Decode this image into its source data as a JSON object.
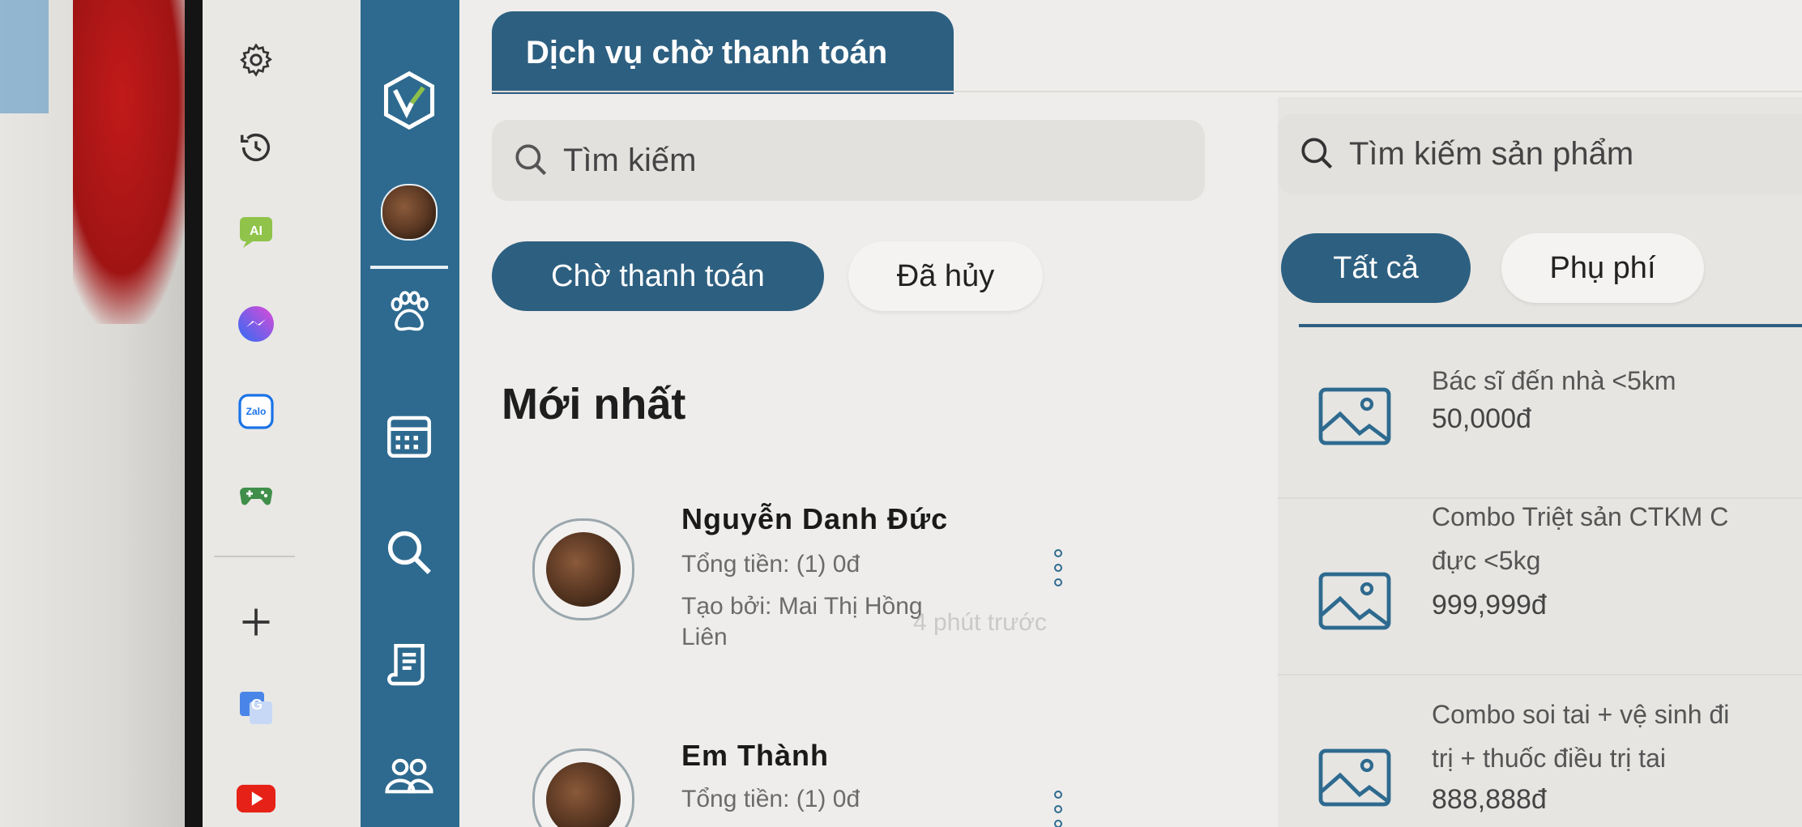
{
  "header": {
    "title": "Dịch vụ chờ thanh toán"
  },
  "search": {
    "orders_placeholder": "Tìm kiếm",
    "products_placeholder": "Tìm kiếm sản phẩm"
  },
  "order_tabs": [
    {
      "label": "Chờ thanh toán",
      "active": true
    },
    {
      "label": "Đã hủy",
      "active": false
    }
  ],
  "section_title": "Mới nhất",
  "orders": [
    {
      "name": "Nguyễn Danh Đức",
      "total": "Tổng tiền: (1) 0đ",
      "created_by_line1": "Tạo bởi: Mai Thị Hồng",
      "created_by_line2": "Liên",
      "time": "4 phút trước"
    },
    {
      "name": "Em Thành",
      "total": "Tổng tiền: (1) 0đ"
    }
  ],
  "product_tabs": [
    {
      "label": "Tất cả",
      "active": true
    },
    {
      "label": "Phụ phí",
      "active": false
    }
  ],
  "products": [
    {
      "name_line1": "Bác sĩ đến nhà <5km",
      "name_line2": "",
      "price": "50,000đ"
    },
    {
      "name_line1": "Combo Triệt sản CTKM C",
      "name_line2": "đực <5kg",
      "price": "999,999đ"
    },
    {
      "name_line1": "Combo soi tai + vệ sinh đi",
      "name_line2": "trị + thuốc điều trị tai",
      "price": "888,888đ"
    }
  ],
  "colors": {
    "primary": "#2d5f80",
    "nav": "#2e6a8f",
    "background": "#eeedeb"
  },
  "icons": {
    "app_strip": [
      "gear-icon",
      "history-icon",
      "ai-icon",
      "messenger-icon",
      "zalo-icon",
      "gamepad-icon",
      "plus-icon",
      "translate-icon",
      "youtube-icon"
    ],
    "nav": [
      "logo-icon",
      "avatar",
      "paw-icon",
      "calendar-icon",
      "search-icon",
      "document-icon",
      "users-icon"
    ]
  },
  "app_badges": {
    "ai": "AI",
    "zalo": "Zalo"
  }
}
